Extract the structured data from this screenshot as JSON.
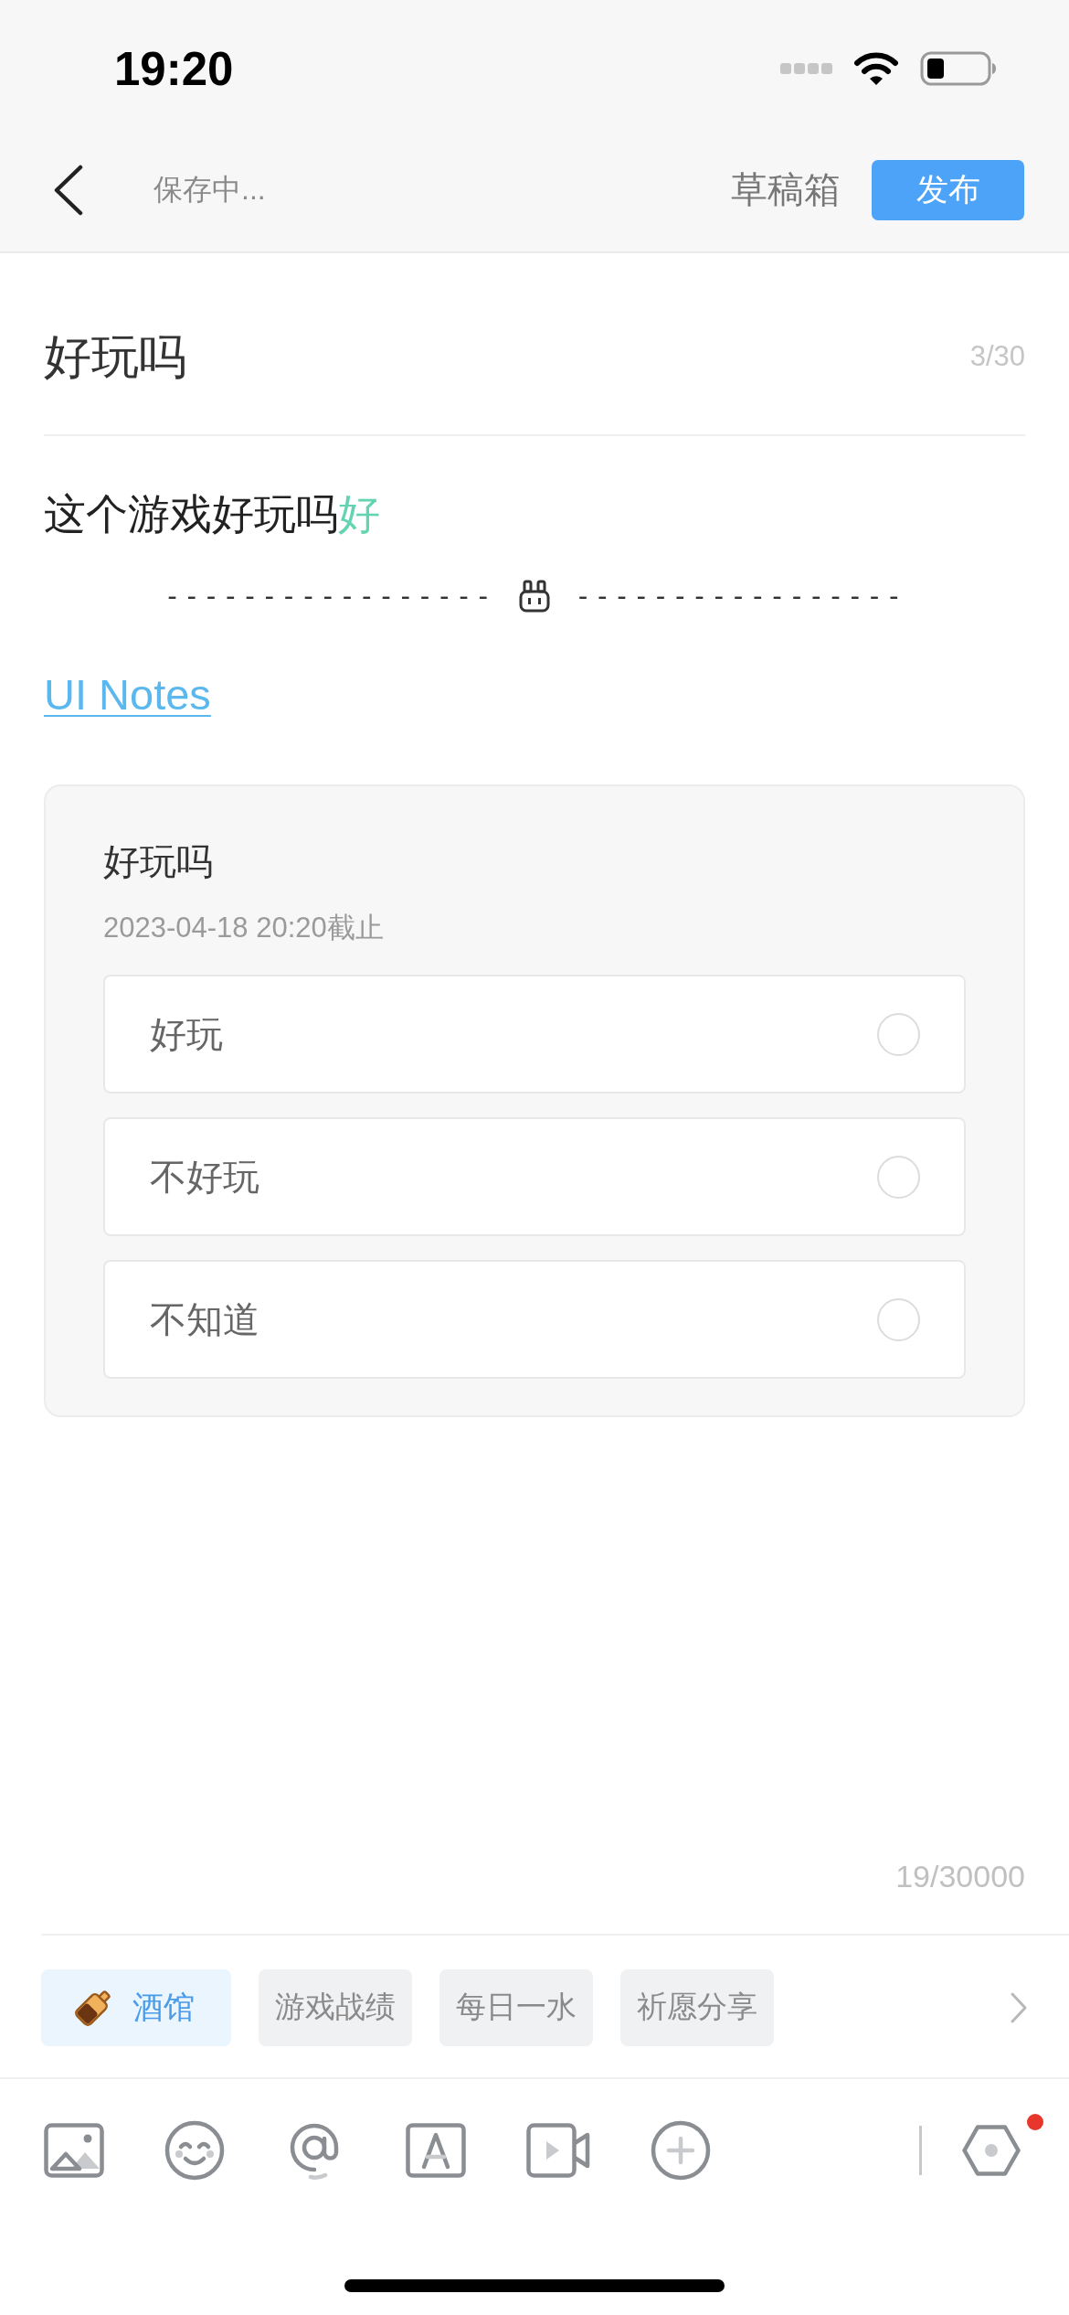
{
  "status_bar": {
    "time": "19:20"
  },
  "nav": {
    "save_status": "保存中...",
    "drafts": "草稿箱",
    "publish": "发布"
  },
  "post": {
    "title": "好玩吗",
    "title_count": "3/30",
    "body": [
      {
        "kind": "text",
        "text": "这个游戏好玩吗"
      },
      {
        "kind": "composing",
        "text": "好"
      }
    ],
    "separator": {
      "left": "-----------------",
      "right": "-----------------"
    },
    "link": "UI Notes",
    "poll": {
      "title": "好玩吗",
      "deadline": "2023-04-18 20:20截止",
      "options": [
        {
          "label": "好玩",
          "selected": false
        },
        {
          "label": "不好玩",
          "selected": false
        },
        {
          "label": "不知道",
          "selected": false
        }
      ]
    },
    "body_count": "19/30000"
  },
  "topics": [
    {
      "label": "酒馆",
      "selected": true
    },
    {
      "label": "游戏战绩",
      "selected": false
    },
    {
      "label": "每日一水",
      "selected": false
    },
    {
      "label": "祈愿分享",
      "selected": false
    }
  ],
  "toolbar": {
    "notification_dot": true
  }
}
